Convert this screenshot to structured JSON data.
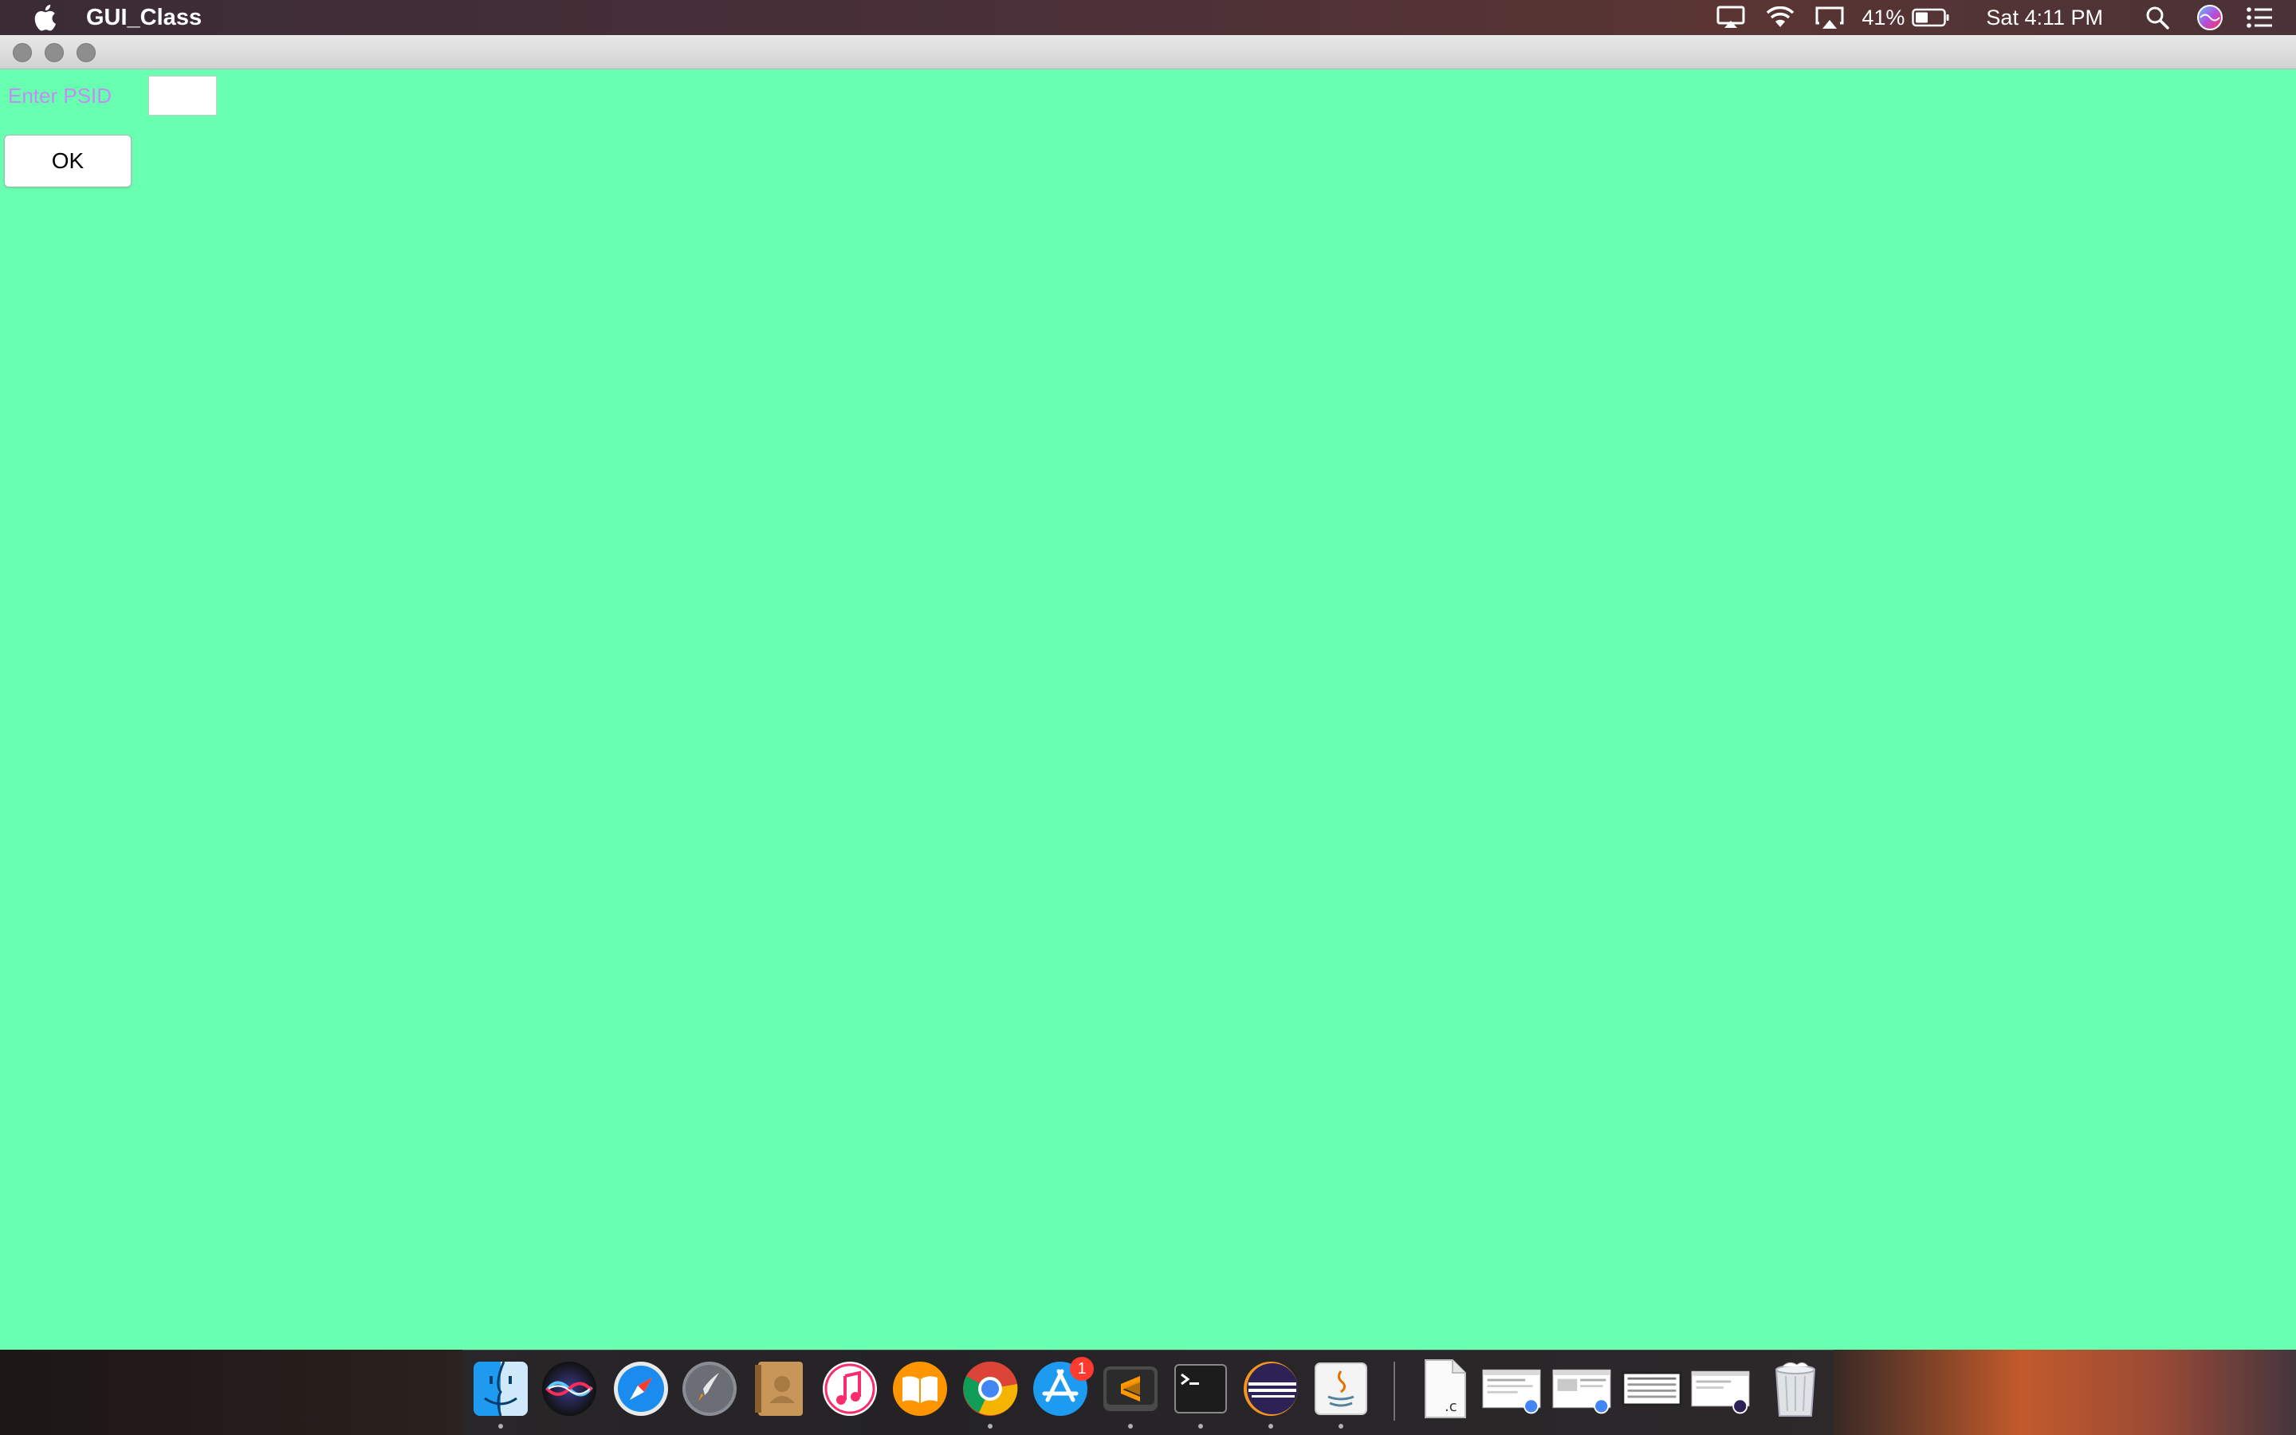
{
  "menubar": {
    "app_name": "GUI_Class",
    "battery_percent": "41%",
    "clock": "Sat 4:11 PM",
    "icons": [
      "apple-icon",
      "airplay-display-icon",
      "wifi-icon",
      "airplay-icon",
      "battery-icon",
      "spotlight-search-icon",
      "siri-icon",
      "notification-center-icon"
    ]
  },
  "window": {
    "buttons": [
      "close",
      "minimize",
      "zoom"
    ],
    "background_color": "#69ffb1",
    "psid_label": "Enter PSID",
    "psid_value": "",
    "ok_label": "OK"
  },
  "dock": {
    "apps": [
      {
        "name": "finder-icon",
        "running": true
      },
      {
        "name": "siri-icon",
        "running": false
      },
      {
        "name": "safari-icon",
        "running": false
      },
      {
        "name": "launchpad-icon",
        "running": false
      },
      {
        "name": "contacts-icon",
        "running": false
      },
      {
        "name": "itunes-icon",
        "running": false
      },
      {
        "name": "ibooks-icon",
        "running": false
      },
      {
        "name": "chrome-icon",
        "running": true
      },
      {
        "name": "app-store-icon",
        "running": false,
        "badge": "1"
      },
      {
        "name": "sublime-text-icon",
        "running": true
      },
      {
        "name": "terminal-icon",
        "running": true
      },
      {
        "name": "eclipse-icon",
        "running": true
      },
      {
        "name": "java-icon",
        "running": true
      }
    ],
    "documents": [
      "c-file-icon",
      "chrome-window-thumbnail",
      "chrome-window-thumbnail",
      "spreadsheet-thumbnail",
      "eclipse-window-thumbnail",
      "trash-icon"
    ]
  }
}
